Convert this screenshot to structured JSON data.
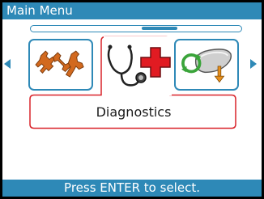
{
  "title": "Main Menu",
  "menu": {
    "items": [
      {
        "icon": "tools-icon",
        "label": ""
      },
      {
        "icon": "stethoscope-medical-cross-icon",
        "label": "Diagnostics",
        "selected": true
      },
      {
        "icon": "refresh-device-icon",
        "label": ""
      }
    ],
    "selected_label": "Diagnostics",
    "scroll_position": 0.64
  },
  "footer": {
    "hint": "Press ENTER to select."
  },
  "colors": {
    "accent": "#2e89b7",
    "selection": "#d9232a",
    "icon_orange": "#d2691e"
  }
}
